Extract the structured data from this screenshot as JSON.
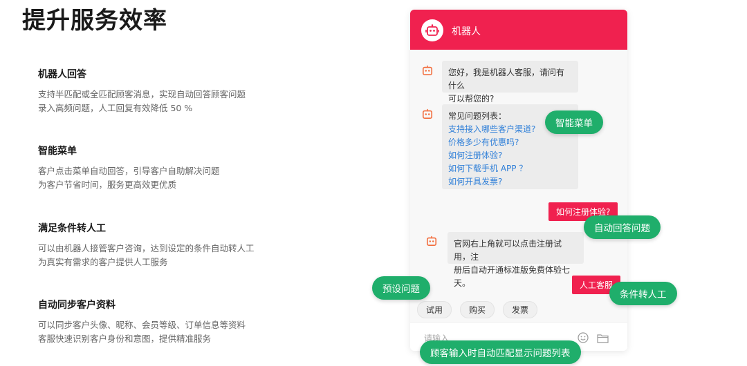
{
  "page": {
    "title": "提升服务效率"
  },
  "features": [
    {
      "title": "机器人回答",
      "lines": [
        "支持半匹配或全匹配顾客消息，实现自动回答顾客问题",
        "录入高频问题，人工回复有效降低 50 %"
      ]
    },
    {
      "title": "智能菜单",
      "lines": [
        "客户点击菜单自动回答，引导客户自助解决问题",
        "为客户节省时间，服务更高效更优质"
      ]
    },
    {
      "title": "满足条件转人工",
      "lines": [
        "可以由机器人接管客户咨询，达到设定的条件自动转人工",
        "为真实有需求的客户提供人工服务"
      ]
    },
    {
      "title": "自动同步客户资料",
      "lines": [
        "可以同步客户头像、昵称、会员等级、订单信息等资料",
        "客服快速识别客户身份和意图，提供精准服务"
      ]
    }
  ],
  "chat": {
    "header_name": "机器人",
    "greeting_lines": [
      "您好，我是机器人客服，请问有什么",
      "可以帮您的?"
    ],
    "faq_title": "常见问题列表：",
    "faq_links": [
      "支持接入哪些客户渠道?",
      "价格多少有优惠吗?",
      "如何注册体验?",
      "如何下载手机 APP ？",
      "如何开具发票?"
    ],
    "user_msg_1": "如何注册体验?",
    "answer_lines": [
      "官网右上角就可以点击注册试用，注",
      "册后自动开通标准版免费体验七天。"
    ],
    "user_msg_2": "人工客服",
    "quick_buttons": [
      "试用",
      "购买",
      "发票"
    ],
    "input_placeholder": "请输入"
  },
  "tags": {
    "smart_menu": "智能菜单",
    "auto_answer": "自动回答问题",
    "preset": "预设问题",
    "transfer": "条件转人工",
    "auto_match": "顾客输入时自动匹配显示问题列表"
  },
  "colors": {
    "brand": "#f0214f",
    "tag": "#1fae6b",
    "link": "#2f7fd8"
  }
}
